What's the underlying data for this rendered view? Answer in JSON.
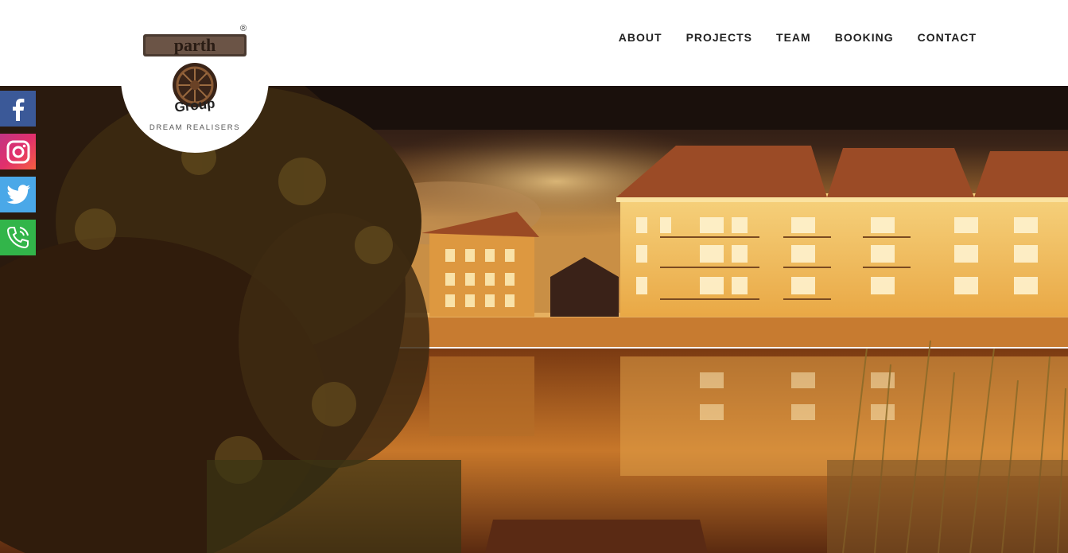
{
  "brand": {
    "logo_word": "parth",
    "logo_sub": "Group",
    "registered_mark": "®",
    "tagline": "DREAM REALISERS"
  },
  "nav": {
    "items": [
      {
        "label": "ABOUT"
      },
      {
        "label": "PROJECTS"
      },
      {
        "label": "TEAM"
      },
      {
        "label": "BOOKING"
      },
      {
        "label": "CONTACT"
      }
    ]
  },
  "social": {
    "items": [
      {
        "icon": "facebook-icon"
      },
      {
        "icon": "instagram-icon"
      },
      {
        "icon": "twitter-icon"
      },
      {
        "icon": "phone-icon"
      }
    ]
  },
  "colors": {
    "facebook": "#3b5998",
    "twitter": "#4aa8e8",
    "phone": "#32b54a",
    "nav_text": "#222222"
  }
}
